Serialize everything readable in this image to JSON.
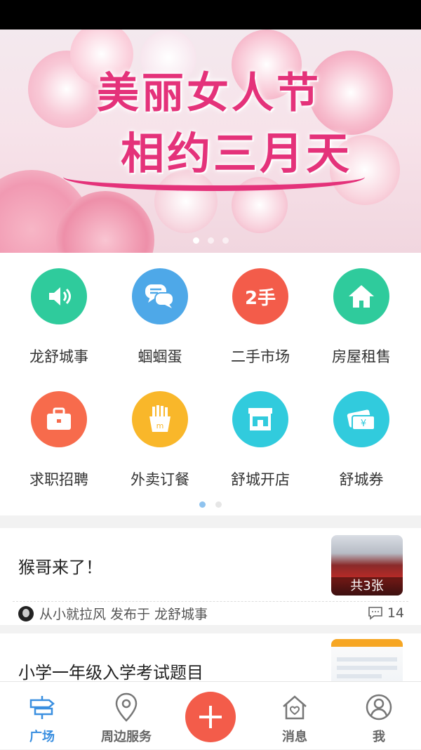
{
  "banner": {
    "line1": "美丽女人节",
    "line2": "相约三月天",
    "pages": 3,
    "active_page": 0
  },
  "grid": {
    "items": [
      {
        "label": "龙舒城事",
        "icon": "speaker-icon",
        "color": "#2fcb9c"
      },
      {
        "label": "蝈蝈蛋",
        "icon": "chat-bubbles-icon",
        "color": "#4ea8e8"
      },
      {
        "label": "二手市场",
        "icon": "second-hand-icon",
        "icon_text": "2手",
        "color": "#f35c4a"
      },
      {
        "label": "房屋租售",
        "icon": "house-icon",
        "color": "#2fcb9c"
      },
      {
        "label": "求职招聘",
        "icon": "briefcase-icon",
        "color": "#f76b4c"
      },
      {
        "label": "外卖订餐",
        "icon": "fries-icon",
        "color": "#f9b72a"
      },
      {
        "label": "舒城开店",
        "icon": "storefront-icon",
        "color": "#31cbdd"
      },
      {
        "label": "舒城券",
        "icon": "coupon-icon",
        "color": "#31cbdd"
      }
    ],
    "pages": 2,
    "active_page": 0
  },
  "feed": [
    {
      "title": "猴哥来了！",
      "thumb_label": "共3张",
      "author": "从小就拉风",
      "published_in": "发布于",
      "channel": "龙舒城事",
      "comments": "14"
    },
    {
      "title": "小学一年级入学考试题目"
    }
  ],
  "nav": {
    "items": [
      {
        "label": "广场",
        "icon": "plaza-icon",
        "active": true
      },
      {
        "label": "周边服务",
        "icon": "location-pin-icon",
        "active": false
      },
      {
        "label": "",
        "icon": "plus-icon"
      },
      {
        "label": "消息",
        "icon": "home-heart-icon",
        "active": false
      },
      {
        "label": "我",
        "icon": "user-icon",
        "active": false
      }
    ],
    "active_color": "#3a8fe0",
    "publish_color": "#f35c4a"
  }
}
